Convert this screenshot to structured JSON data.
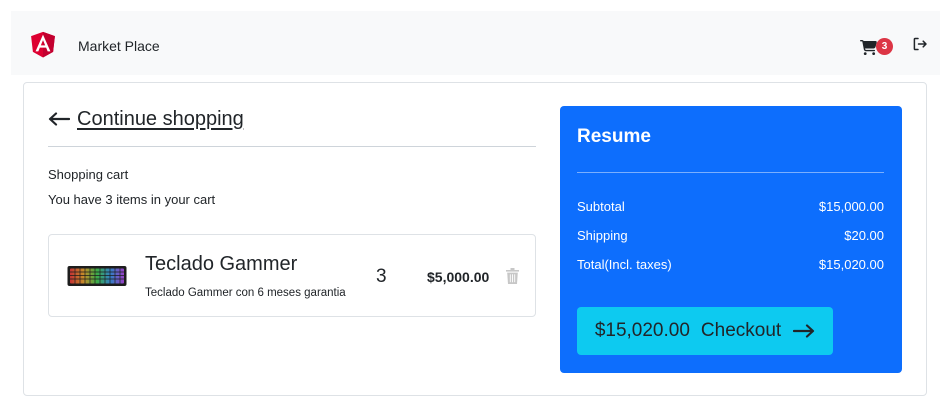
{
  "navbar": {
    "brand": "Market Place",
    "cart_count": "3",
    "logo_icon": "angular-logo",
    "cart_icon": "cart-icon",
    "logout_icon": "logout-icon"
  },
  "cart": {
    "continue_label": "Continue shopping",
    "title": "Shopping cart",
    "subtitle": "You have 3 items in your cart",
    "items": [
      {
        "name": "Teclado Gammer",
        "description": "Teclado Gammer con 6 meses garantia",
        "quantity": "3",
        "price": "$5,000.00"
      }
    ]
  },
  "summary": {
    "title": "Resume",
    "rows": [
      {
        "label": "Subtotal",
        "value": "$15,000.00"
      },
      {
        "label": "Shipping",
        "value": "$20.00"
      },
      {
        "label": "Total(Incl. taxes)",
        "value": "$15,020.00"
      }
    ],
    "checkout_amount": "$15,020.00",
    "checkout_label": "Checkout"
  },
  "colors": {
    "primary": "#0d6efd",
    "info": "#0dcaf0",
    "danger": "#dc3545",
    "angular": "#dd0031"
  }
}
